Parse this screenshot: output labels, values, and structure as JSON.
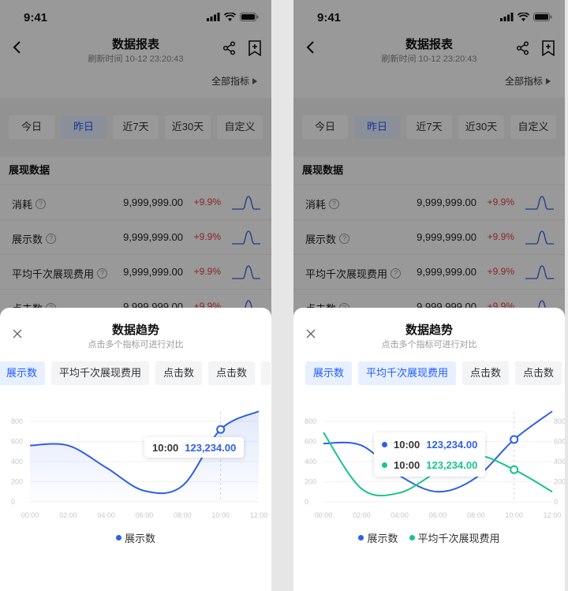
{
  "status": {
    "time": "9:41"
  },
  "nav": {
    "title": "数据报表",
    "subtitle": "刷新时间 10-12 23:20:43"
  },
  "all_metrics_label": "全部指标",
  "date_tabs": [
    {
      "label": "今日"
    },
    {
      "label": "昨日",
      "active": true
    },
    {
      "label": "近7天"
    },
    {
      "label": "近30天"
    },
    {
      "label": "自定义"
    }
  ],
  "section_title": "展现数据",
  "metrics": [
    {
      "name": "消耗",
      "value": "9,999,999.00",
      "change": "+9.9%"
    },
    {
      "name": "展示数",
      "value": "9,999,999.00",
      "change": "+9.9%"
    },
    {
      "name": "平均千次展现费用",
      "value": "9,999,999.00",
      "change": "+9.9%"
    },
    {
      "name": "点击数",
      "value": "9,999,999.00",
      "change": "+9.9%"
    }
  ],
  "sheet": {
    "title": "数据趋势",
    "subtitle": "点击多个指标可进行对比"
  },
  "screens": [
    {
      "chips": [
        {
          "label": "展示数",
          "active": true
        },
        {
          "label": "平均千次展现费用",
          "active": false
        },
        {
          "label": "点击数",
          "active": false
        },
        {
          "label": "点击数",
          "active": false
        }
      ],
      "tooltip": [
        {
          "time": "10:00",
          "value": "123,234.00",
          "color": "#2f5fe8"
        }
      ],
      "legend": [
        {
          "label": "展示数",
          "color": "#2f5fe8"
        }
      ]
    },
    {
      "chips": [
        {
          "label": "展示数",
          "active": true
        },
        {
          "label": "平均千次展现费用",
          "active": true
        },
        {
          "label": "点击数",
          "active": false
        },
        {
          "label": "点击数",
          "active": false
        }
      ],
      "tooltip": [
        {
          "time": "10:00",
          "value": "123,234.00",
          "color": "#2f5fe8"
        },
        {
          "time": "10:00",
          "value": "123,234.00",
          "color": "#19c48a"
        }
      ],
      "legend": [
        {
          "label": "展示数",
          "color": "#2f5fe8"
        },
        {
          "label": "平均千次展现费用",
          "color": "#19c48a"
        }
      ]
    }
  ],
  "chart_data": [
    {
      "type": "line",
      "x": [
        "00:00",
        "02:00",
        "04:00",
        "06:00",
        "08:00",
        "10:00",
        "12:00"
      ],
      "y_ticks": [
        0,
        200,
        400,
        600,
        800
      ],
      "ylim": [
        0,
        800
      ],
      "series": [
        {
          "name": "展示数",
          "color": "#2f5fe8",
          "values": [
            560,
            560,
            340,
            110,
            160,
            720,
            900
          ]
        }
      ],
      "highlight_x": "10:00",
      "grid": true
    },
    {
      "type": "line",
      "x": [
        "00:00",
        "02:00",
        "04:00",
        "06:00",
        "08:00",
        "10:00",
        "12:00"
      ],
      "y_ticks": [
        0,
        200,
        400,
        600,
        800
      ],
      "ylim": [
        0,
        800
      ],
      "series": [
        {
          "name": "展示数",
          "color": "#2f5fe8",
          "values": [
            580,
            560,
            260,
            100,
            240,
            620,
            900
          ]
        },
        {
          "name": "平均千次展现费用",
          "color": "#19c48a",
          "values": [
            690,
            130,
            90,
            300,
            460,
            320,
            100
          ]
        }
      ],
      "highlight_x": "10:00",
      "grid": true,
      "dual_axis": true
    }
  ]
}
